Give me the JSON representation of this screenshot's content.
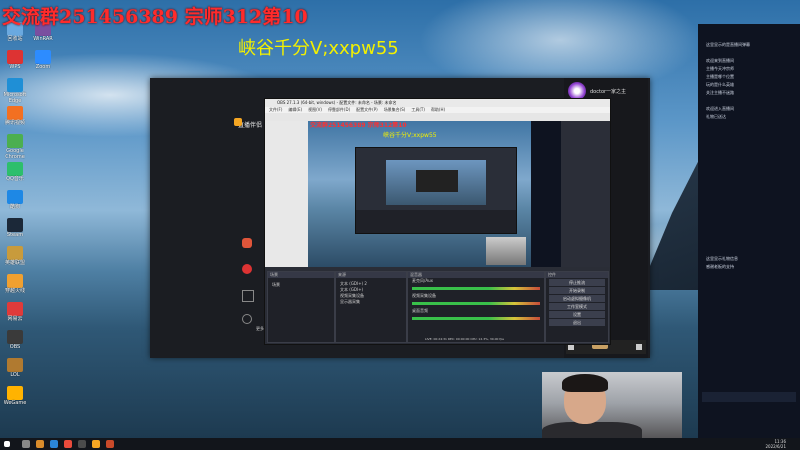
{
  "overlay": {
    "main_text": "交流群251456389 宗师312第10",
    "sub_text": "峡谷千分V;xxpw55"
  },
  "desktop_icons": [
    "回收站",
    "WPS",
    "Microsoft Edge",
    "腾讯视频",
    "Google Chrome",
    "QQ音乐",
    "酷狗",
    "Steam",
    "英雄联盟",
    "穿越火线",
    "网易云",
    "OBS",
    "LOL",
    "WeGame",
    "WinRAR",
    "Zoom"
  ],
  "main_window": {
    "app_title": "直播伴侣",
    "host_name": "doctor一家之主",
    "bottom_label": "更多"
  },
  "obs": {
    "title": "OBS 27.1.3 (64-bit, windows) - 配置文件: 未命名 - 场景: 未命名",
    "menu": [
      "文件(F)",
      "编辑(E)",
      "视图(V)",
      "停靠部件(D)",
      "配置文件(P)",
      "场景集合(S)",
      "工具(T)",
      "帮助(H)"
    ],
    "preview_overlay_main": "交流群251456389 宗师312第10",
    "preview_overlay_sub": "峡谷千分V;xxpw55",
    "docks": {
      "scenes_title": "场景",
      "scene_items": [
        "场景"
      ],
      "sources_title": "来源",
      "source_items": [
        "文本 (GDI+) 2",
        "文本 (GDI+)",
        "视频采集设备",
        "显示器采集"
      ],
      "mixer_title": "混音器",
      "mixer_channels": [
        "麦克风/Aux",
        "视频采集设备",
        "桌面音频"
      ],
      "controls_title": "控件",
      "controls": [
        "停止推流",
        "开始录制",
        "启动虚拟摄像机",
        "工作室模式",
        "设置",
        "退出"
      ]
    },
    "status": "LIVE: 00:24:31  REC: 00:00:00  CPU: 12.3%, 30.00 fps"
  },
  "right_panel": {
    "lines": [
      "这里显示的是直播间弹幕",
      "",
      "欢迎来到直播间",
      "主播今天冲宗师",
      "主播是哪个位置",
      "玩的是什么英雄",
      "关注主播不迷路",
      "",
      "欢迎进入直播间",
      "礼物已送达"
    ],
    "footer_lines": [
      "这里显示礼物信息",
      "感谢老板的支持"
    ]
  },
  "taskbar": {
    "time": "11:36",
    "date": "2022/6/21"
  }
}
